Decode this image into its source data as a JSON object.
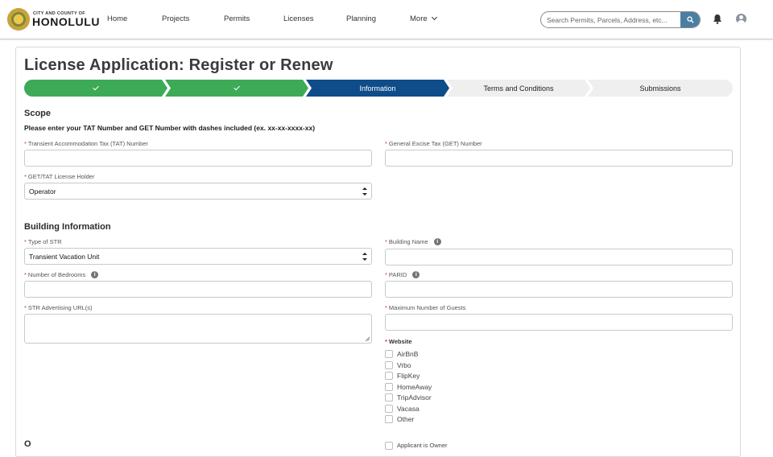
{
  "header": {
    "logo_small": "CITY AND COUNTY OF",
    "logo_big": "HONOLULU",
    "nav": [
      "Home",
      "Projects",
      "Permits",
      "Licenses",
      "Planning"
    ],
    "more_label": "More",
    "search_placeholder": "Search Permits, Parcels, Address, etc..."
  },
  "page": {
    "title": "License Application: Register or Renew"
  },
  "steps": [
    {
      "label": "",
      "state": "complete"
    },
    {
      "label": "",
      "state": "complete"
    },
    {
      "label": "Information",
      "state": "current"
    },
    {
      "label": "Terms and Conditions",
      "state": "upcoming"
    },
    {
      "label": "Submissions",
      "state": "upcoming"
    }
  ],
  "colors": {
    "complete": "#3daa57",
    "current": "#0f4c8a",
    "upcoming": "#efefef",
    "required": "#c23934"
  },
  "scope": {
    "title": "Scope",
    "instruction": "Please enter your TAT Number and GET Number with dashes included (ex. xx-xx-xxxx-xx)",
    "tat_label": "Transient Accommodation Tax (TAT) Number",
    "get_label": "General Excise Tax (GET) Number",
    "holder_label": "GET/TAT License Holder",
    "holder_value": "Operator"
  },
  "building": {
    "title": "Building Information",
    "type_label": "Type of STR",
    "type_value": "Transient Vacation Unit",
    "name_label": "Building Name",
    "bedrooms_label": "Number of Bedrooms",
    "parid_label": "PARID",
    "url_label": "STR Advertising URL(s)",
    "guests_label": "Maximum Number of Guests",
    "website_label": "Website",
    "websites": [
      "AirBnB",
      "Vrbo",
      "FlipKey",
      "HomeAway",
      "TripAdvisor",
      "Vacasa",
      "Other"
    ],
    "partial_next": "Applicant is Owner"
  }
}
